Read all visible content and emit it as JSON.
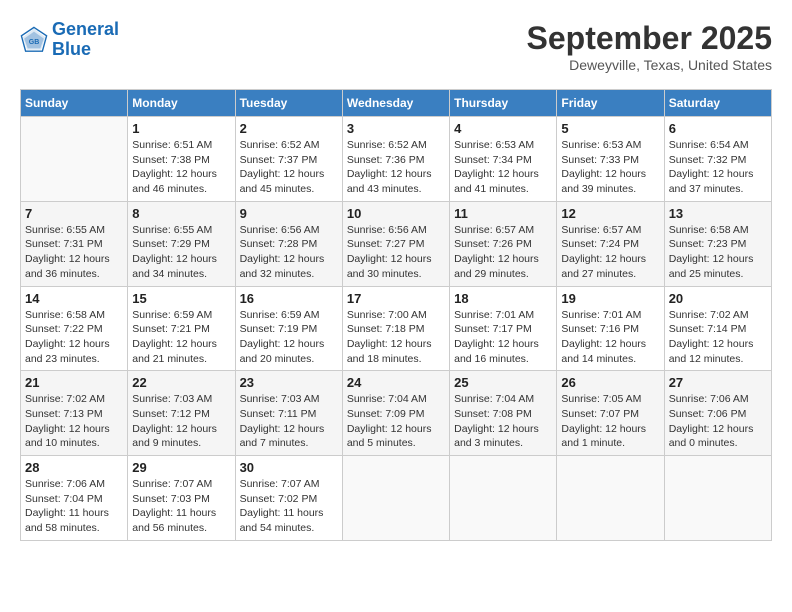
{
  "header": {
    "logo_line1": "General",
    "logo_line2": "Blue",
    "month": "September 2025",
    "location": "Deweyville, Texas, United States"
  },
  "columns": [
    "Sunday",
    "Monday",
    "Tuesday",
    "Wednesday",
    "Thursday",
    "Friday",
    "Saturday"
  ],
  "weeks": [
    [
      {
        "day": "",
        "info": ""
      },
      {
        "day": "1",
        "info": "Sunrise: 6:51 AM\nSunset: 7:38 PM\nDaylight: 12 hours\nand 46 minutes."
      },
      {
        "day": "2",
        "info": "Sunrise: 6:52 AM\nSunset: 7:37 PM\nDaylight: 12 hours\nand 45 minutes."
      },
      {
        "day": "3",
        "info": "Sunrise: 6:52 AM\nSunset: 7:36 PM\nDaylight: 12 hours\nand 43 minutes."
      },
      {
        "day": "4",
        "info": "Sunrise: 6:53 AM\nSunset: 7:34 PM\nDaylight: 12 hours\nand 41 minutes."
      },
      {
        "day": "5",
        "info": "Sunrise: 6:53 AM\nSunset: 7:33 PM\nDaylight: 12 hours\nand 39 minutes."
      },
      {
        "day": "6",
        "info": "Sunrise: 6:54 AM\nSunset: 7:32 PM\nDaylight: 12 hours\nand 37 minutes."
      }
    ],
    [
      {
        "day": "7",
        "info": "Sunrise: 6:55 AM\nSunset: 7:31 PM\nDaylight: 12 hours\nand 36 minutes."
      },
      {
        "day": "8",
        "info": "Sunrise: 6:55 AM\nSunset: 7:29 PM\nDaylight: 12 hours\nand 34 minutes."
      },
      {
        "day": "9",
        "info": "Sunrise: 6:56 AM\nSunset: 7:28 PM\nDaylight: 12 hours\nand 32 minutes."
      },
      {
        "day": "10",
        "info": "Sunrise: 6:56 AM\nSunset: 7:27 PM\nDaylight: 12 hours\nand 30 minutes."
      },
      {
        "day": "11",
        "info": "Sunrise: 6:57 AM\nSunset: 7:26 PM\nDaylight: 12 hours\nand 29 minutes."
      },
      {
        "day": "12",
        "info": "Sunrise: 6:57 AM\nSunset: 7:24 PM\nDaylight: 12 hours\nand 27 minutes."
      },
      {
        "day": "13",
        "info": "Sunrise: 6:58 AM\nSunset: 7:23 PM\nDaylight: 12 hours\nand 25 minutes."
      }
    ],
    [
      {
        "day": "14",
        "info": "Sunrise: 6:58 AM\nSunset: 7:22 PM\nDaylight: 12 hours\nand 23 minutes."
      },
      {
        "day": "15",
        "info": "Sunrise: 6:59 AM\nSunset: 7:21 PM\nDaylight: 12 hours\nand 21 minutes."
      },
      {
        "day": "16",
        "info": "Sunrise: 6:59 AM\nSunset: 7:19 PM\nDaylight: 12 hours\nand 20 minutes."
      },
      {
        "day": "17",
        "info": "Sunrise: 7:00 AM\nSunset: 7:18 PM\nDaylight: 12 hours\nand 18 minutes."
      },
      {
        "day": "18",
        "info": "Sunrise: 7:01 AM\nSunset: 7:17 PM\nDaylight: 12 hours\nand 16 minutes."
      },
      {
        "day": "19",
        "info": "Sunrise: 7:01 AM\nSunset: 7:16 PM\nDaylight: 12 hours\nand 14 minutes."
      },
      {
        "day": "20",
        "info": "Sunrise: 7:02 AM\nSunset: 7:14 PM\nDaylight: 12 hours\nand 12 minutes."
      }
    ],
    [
      {
        "day": "21",
        "info": "Sunrise: 7:02 AM\nSunset: 7:13 PM\nDaylight: 12 hours\nand 10 minutes."
      },
      {
        "day": "22",
        "info": "Sunrise: 7:03 AM\nSunset: 7:12 PM\nDaylight: 12 hours\nand 9 minutes."
      },
      {
        "day": "23",
        "info": "Sunrise: 7:03 AM\nSunset: 7:11 PM\nDaylight: 12 hours\nand 7 minutes."
      },
      {
        "day": "24",
        "info": "Sunrise: 7:04 AM\nSunset: 7:09 PM\nDaylight: 12 hours\nand 5 minutes."
      },
      {
        "day": "25",
        "info": "Sunrise: 7:04 AM\nSunset: 7:08 PM\nDaylight: 12 hours\nand 3 minutes."
      },
      {
        "day": "26",
        "info": "Sunrise: 7:05 AM\nSunset: 7:07 PM\nDaylight: 12 hours\nand 1 minute."
      },
      {
        "day": "27",
        "info": "Sunrise: 7:06 AM\nSunset: 7:06 PM\nDaylight: 12 hours\nand 0 minutes."
      }
    ],
    [
      {
        "day": "28",
        "info": "Sunrise: 7:06 AM\nSunset: 7:04 PM\nDaylight: 11 hours\nand 58 minutes."
      },
      {
        "day": "29",
        "info": "Sunrise: 7:07 AM\nSunset: 7:03 PM\nDaylight: 11 hours\nand 56 minutes."
      },
      {
        "day": "30",
        "info": "Sunrise: 7:07 AM\nSunset: 7:02 PM\nDaylight: 11 hours\nand 54 minutes."
      },
      {
        "day": "",
        "info": ""
      },
      {
        "day": "",
        "info": ""
      },
      {
        "day": "",
        "info": ""
      },
      {
        "day": "",
        "info": ""
      }
    ]
  ]
}
